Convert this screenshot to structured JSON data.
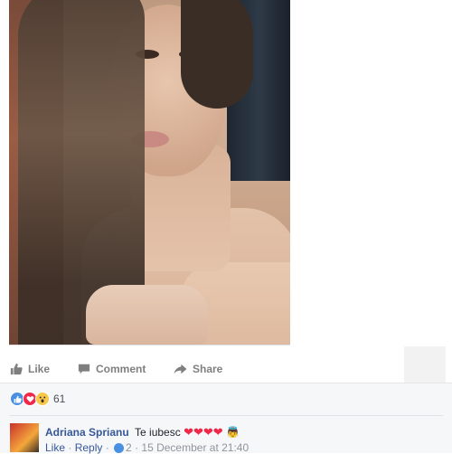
{
  "post": {
    "actions": {
      "like_label": "Like",
      "comment_label": "Comment",
      "share_label": "Share"
    },
    "reactions": {
      "icons": [
        "like-icon",
        "love-icon",
        "wow-icon"
      ],
      "count": "61"
    }
  },
  "comment": {
    "author": "Adriana Sprianu",
    "text": "Te iubesc",
    "emoji": "❤❤❤❤",
    "meta": {
      "like_label": "Like",
      "reply_label": "Reply",
      "reaction_count": "2",
      "timestamp": "· 15 December at 21:40"
    }
  },
  "colors": {
    "link": "#365899",
    "action_text": "#7f7f7f",
    "like_blue": "#4a90e2",
    "love_red": "#f0284a",
    "wow_yellow": "#f7c84a",
    "bar_bg": "#f6f7f9"
  }
}
